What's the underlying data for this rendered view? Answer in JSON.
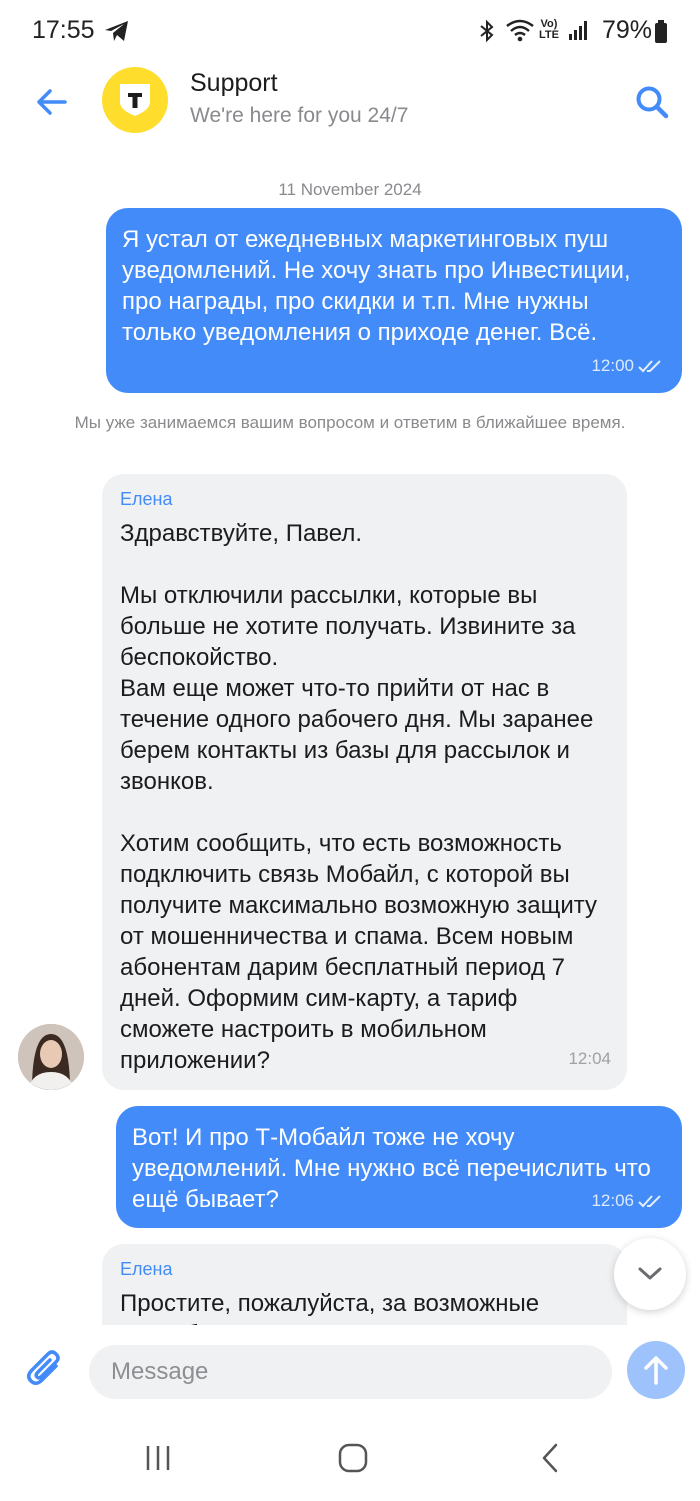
{
  "status_bar": {
    "time": "17:55",
    "battery": "79%",
    "icons": [
      "telegram-icon",
      "bluetooth-icon",
      "wifi-icon",
      "volte-icon",
      "signal-icon",
      "battery-icon"
    ]
  },
  "header": {
    "title": "Support",
    "subtitle": "We're here for you 24/7",
    "logo_letter": "T",
    "accent_color": "#428bf9",
    "logo_color": "#ffdd2d"
  },
  "chat": {
    "date": "11 November 2024",
    "messages": [
      {
        "direction": "outgoing",
        "text": "Я устал от ежедневных маркетинговых пуш уведомлений. Не хочу знать про Инвестиции, про награды, про скидки и т.п. Мне нужны только уведомления о приходе денег. Всё.",
        "time": "12:00",
        "status": "read"
      },
      {
        "direction": "system",
        "text": "Мы уже занимаемся вашим вопросом и ответим в ближайшее время."
      },
      {
        "direction": "incoming",
        "author": "Елена",
        "text": "Здравствуйте, Павел.\n\nМы отключили рассылки, которые вы больше не хотите получать. Извините за беспокойство.\nВам еще может что-то прийти от нас в течение одного рабочего дня. Мы заранее берем контакты из базы для рассылок и звонков.\n\nХотим сообщить, что есть возможность подключить связь Мобайл, с которой вы получите максимально возможную защиту от мошенничества и спама. Всем новым абонентам дарим бесплатный период 7 дней. Оформим сим-карту, а тариф сможете настроить в мобильном приложении?",
        "time": "12:04"
      },
      {
        "direction": "outgoing",
        "text": "Вот! И про Т-Мобайл тоже не хочу уведомлений. Мне нужно всё перечислить что ещё бывает?",
        "time": "12:06",
        "status": "read"
      },
      {
        "direction": "incoming",
        "author": "Елена",
        "text": "Простите, пожалуйста, за возможные неудобства. Т"
      }
    ]
  },
  "composer": {
    "placeholder": "Message"
  }
}
